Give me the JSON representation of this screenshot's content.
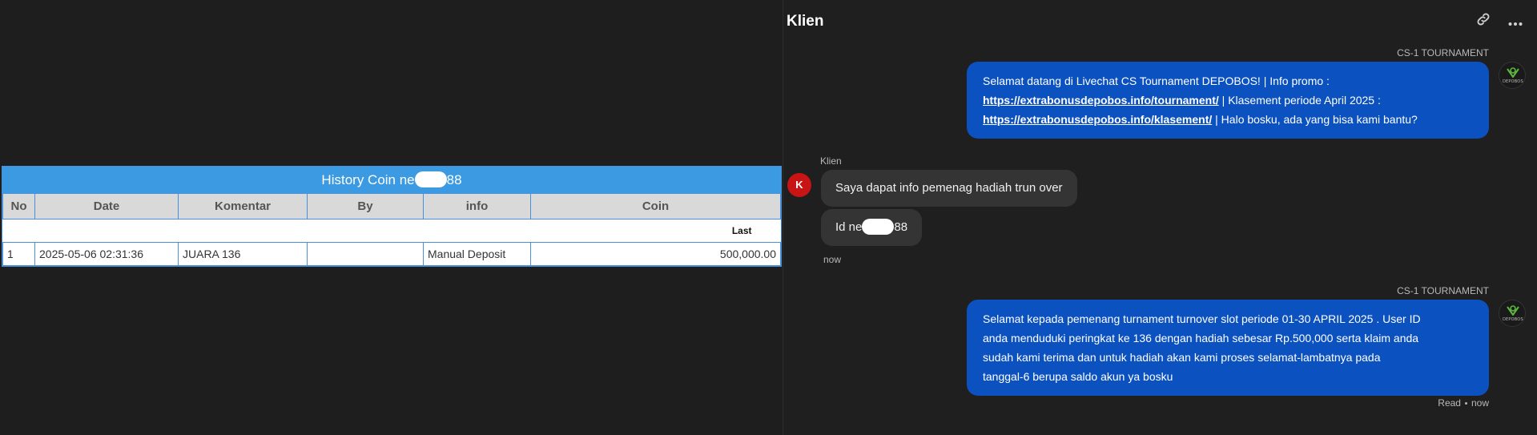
{
  "history": {
    "title_prefix": "History Coin ne",
    "title_suffix": "88",
    "columns": [
      "No",
      "Date",
      "Komentar",
      "By",
      "info",
      "Coin"
    ],
    "sub_label": "Last",
    "rows": [
      {
        "no": "1",
        "date": "2025-05-06 02:31:36",
        "komentar": "JUARA 136",
        "by": "",
        "info": "Manual Deposit",
        "coin": "500,000.00"
      }
    ]
  },
  "chat": {
    "title": "Klien",
    "messages": [
      {
        "sender": "CS-1 TOURNAMENT",
        "line1": "Selamat datang di Livechat CS Tournament DEPOBOS! | Info promo :",
        "link1": "https://extrabonusdepobos.info/tournament/",
        "line2_after_link": " | Klasement periode April 2025 :",
        "link2": "https://extrabonusdepobos.info/klasement/",
        "line3_after_link": " | Halo bosku, ada yang bisa kami bantu?"
      },
      {
        "sender": "Klien",
        "avatar_letter": "K",
        "bubble1": "Saya dapat info pemenag hadiah trun over",
        "bubble2_prefix": "Id ne",
        "bubble2_suffix": "88",
        "time": "now"
      },
      {
        "sender": "CS-1 TOURNAMENT",
        "lines": [
          "Selamat kepada pemenang turnament turnover slot periode 01-30 APRIL 2025 . User ID",
          "anda menduduki peringkat ke 136 dengan hadiah sebesar Rp.500,000 serta klaim anda",
          "sudah kami terima dan untuk hadiah akan kami proses selamat-lambatnya pada",
          "tanggal-6 berupa saldo akun ya bosku"
        ],
        "status": "Read",
        "time": "now"
      }
    ],
    "avatar_brand": "DEPOBOS",
    "icons": {
      "link": "link-icon",
      "more": "more-options-icon"
    },
    "colors": {
      "agent_bubble": "#0b52c0",
      "client_bubble": "#343434",
      "client_avatar": "#c81414",
      "table_header": "#3b9ae1"
    }
  }
}
